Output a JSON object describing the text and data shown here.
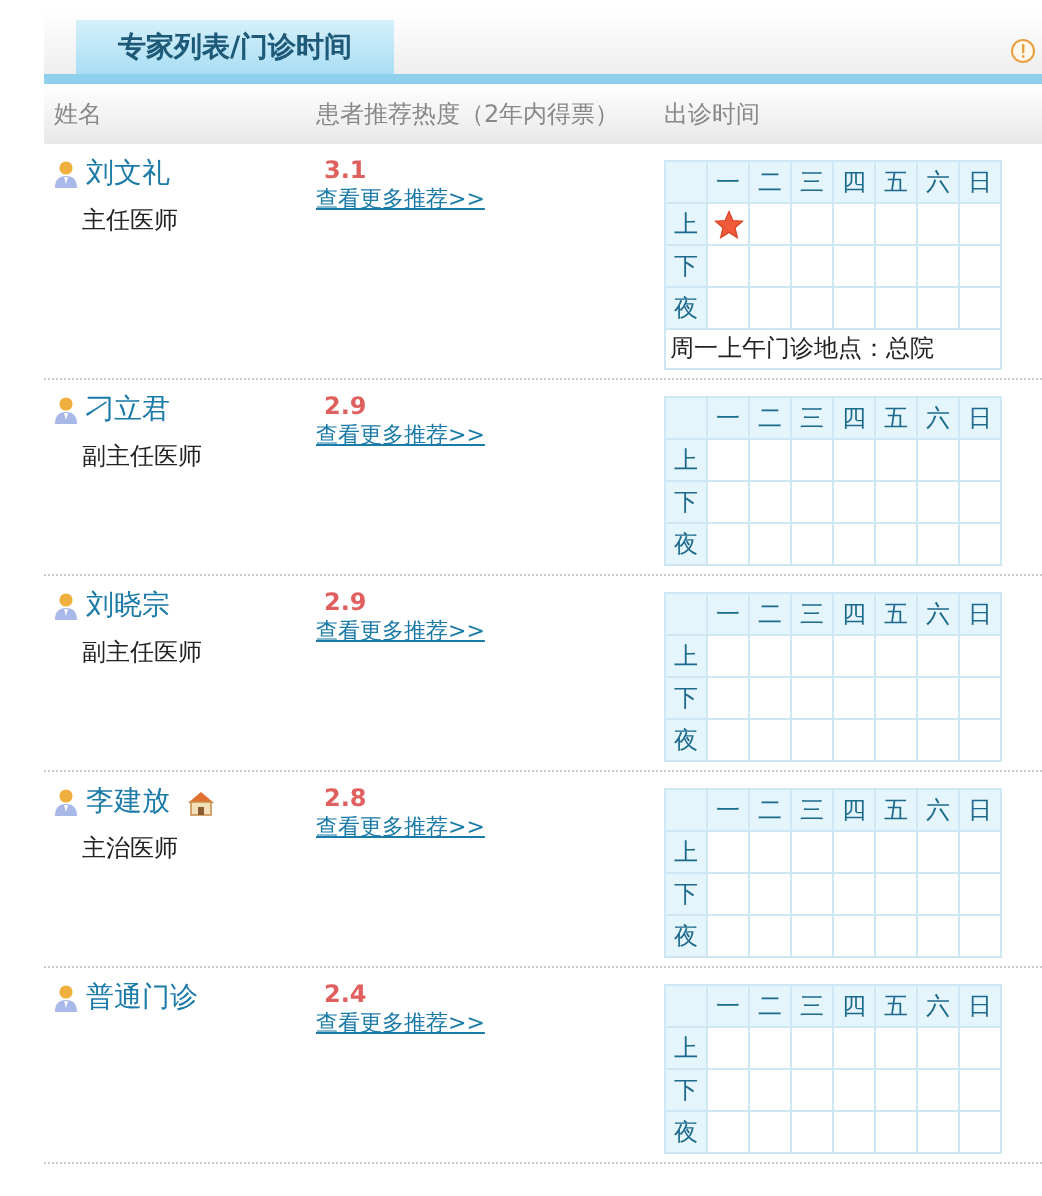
{
  "tab": {
    "label": "专家列表/门诊时间",
    "selected": true
  },
  "columns": [
    "姓名",
    "患者推荐热度（2年内得票）",
    "出诊时间"
  ],
  "doctors": [
    {
      "name": "刘文礼",
      "title": "主任医师",
      "home": false,
      "score": "3.1",
      "link": "查看更多推荐>>",
      "days": [
        "一",
        "二",
        "三",
        "四",
        "五",
        "六",
        "日"
      ],
      "schedule": [
        {
          "label": "上",
          "slots": [
            true,
            false,
            false,
            false,
            false,
            false,
            false
          ]
        },
        {
          "label": "下",
          "slots": [
            false,
            false,
            false,
            false,
            false,
            false,
            false
          ]
        },
        {
          "label": "夜",
          "slots": [
            false,
            false,
            false,
            false,
            false,
            false,
            false
          ]
        }
      ],
      "note": "周一上午门诊地点：总院"
    },
    {
      "name": "刁立君",
      "title": "副主任医师",
      "home": false,
      "score": "2.9",
      "link": "查看更多推荐>>",
      "days": [
        "一",
        "二",
        "三",
        "四",
        "五",
        "六",
        "日"
      ],
      "schedule": [
        {
          "label": "上",
          "slots": [
            false,
            false,
            false,
            false,
            false,
            false,
            false
          ]
        },
        {
          "label": "下",
          "slots": [
            false,
            false,
            false,
            false,
            false,
            false,
            false
          ]
        },
        {
          "label": "夜",
          "slots": [
            false,
            false,
            false,
            false,
            false,
            false,
            false
          ]
        }
      ]
    },
    {
      "name": "刘晓宗",
      "title": "副主任医师",
      "home": false,
      "score": "2.9",
      "link": "查看更多推荐>>",
      "days": [
        "一",
        "二",
        "三",
        "四",
        "五",
        "六",
        "日"
      ],
      "schedule": [
        {
          "label": "上",
          "slots": [
            false,
            false,
            false,
            false,
            false,
            false,
            false
          ]
        },
        {
          "label": "下",
          "slots": [
            false,
            false,
            false,
            false,
            false,
            false,
            false
          ]
        },
        {
          "label": "夜",
          "slots": [
            false,
            false,
            false,
            false,
            false,
            false,
            false
          ]
        }
      ]
    },
    {
      "name": "李建放",
      "title": "主治医师",
      "home": true,
      "score": "2.8",
      "link": "查看更多推荐>>",
      "days": [
        "一",
        "二",
        "三",
        "四",
        "五",
        "六",
        "日"
      ],
      "schedule": [
        {
          "label": "上",
          "slots": [
            false,
            false,
            false,
            false,
            false,
            false,
            false
          ]
        },
        {
          "label": "下",
          "slots": [
            false,
            false,
            false,
            false,
            false,
            false,
            false
          ]
        },
        {
          "label": "夜",
          "slots": [
            false,
            false,
            false,
            false,
            false,
            false,
            false
          ]
        }
      ]
    },
    {
      "name": "普通门诊",
      "home": false,
      "score": "2.4",
      "link": "查看更多推荐>>",
      "days": [
        "一",
        "二",
        "三",
        "四",
        "五",
        "六",
        "日"
      ],
      "schedule": [
        {
          "label": "上",
          "slots": [
            false,
            false,
            false,
            false,
            false,
            false,
            false
          ]
        },
        {
          "label": "下",
          "slots": [
            false,
            false,
            false,
            false,
            false,
            false,
            false
          ]
        },
        {
          "label": "夜",
          "slots": [
            false,
            false,
            false,
            false,
            false,
            false,
            false
          ]
        }
      ]
    }
  ]
}
